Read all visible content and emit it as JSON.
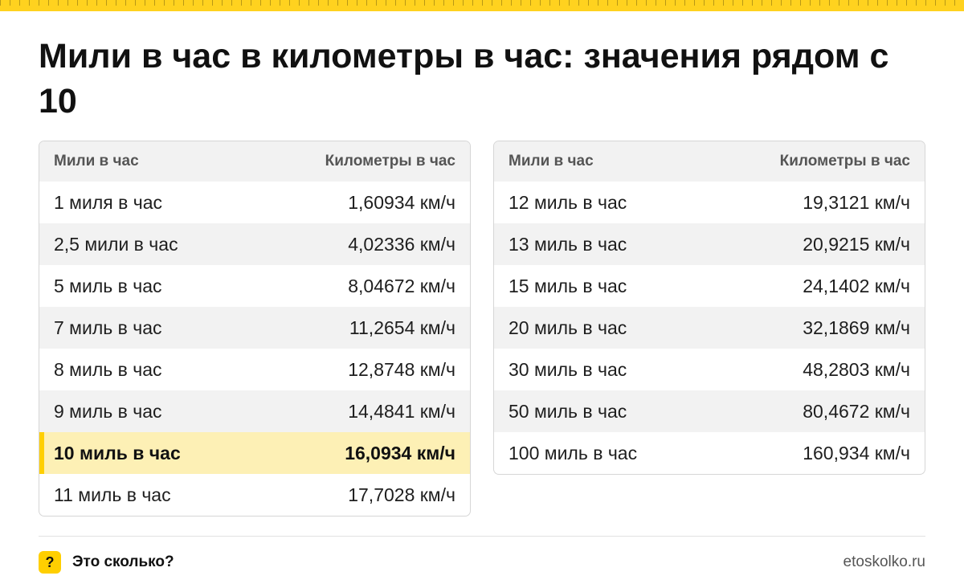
{
  "title": "Мили в час в километры в час: значения рядом с 10",
  "colors": {
    "accent": "#ffcf00",
    "highlight_bg": "#fdf0b5",
    "header_bg": "#f2f2f2"
  },
  "tables": [
    {
      "headers": [
        "Мили в час",
        "Километры в час"
      ],
      "rows": [
        [
          "1 миля в час",
          "1,60934 км/ч"
        ],
        [
          "2,5 мили в час",
          "4,02336 км/ч"
        ],
        [
          "5 миль в час",
          "8,04672 км/ч"
        ],
        [
          "7 миль в час",
          "11,2654 км/ч"
        ],
        [
          "8 миль в час",
          "12,8748 км/ч"
        ],
        [
          "9 миль в час",
          "14,4841 км/ч"
        ],
        [
          "10 миль в час",
          "16,0934 км/ч"
        ],
        [
          "11 миль в час",
          "17,7028 км/ч"
        ]
      ],
      "highlighted_row": 6
    },
    {
      "headers": [
        "Мили в час",
        "Километры в час"
      ],
      "rows": [
        [
          "12 миль в час",
          "19,3121 км/ч"
        ],
        [
          "13 миль в час",
          "20,9215 км/ч"
        ],
        [
          "15 миль в час",
          "24,1402 км/ч"
        ],
        [
          "20 миль в час",
          "32,1869 км/ч"
        ],
        [
          "30 миль в час",
          "48,2803 км/ч"
        ],
        [
          "50 миль в час",
          "80,4672 км/ч"
        ],
        [
          "100 миль в час",
          "160,934 км/ч"
        ]
      ]
    }
  ],
  "footer": {
    "brand_icon": "?",
    "brand_icon_name": "question-mark-icon",
    "brand_name": "Это сколько?",
    "site": "etoskolko.ru"
  }
}
